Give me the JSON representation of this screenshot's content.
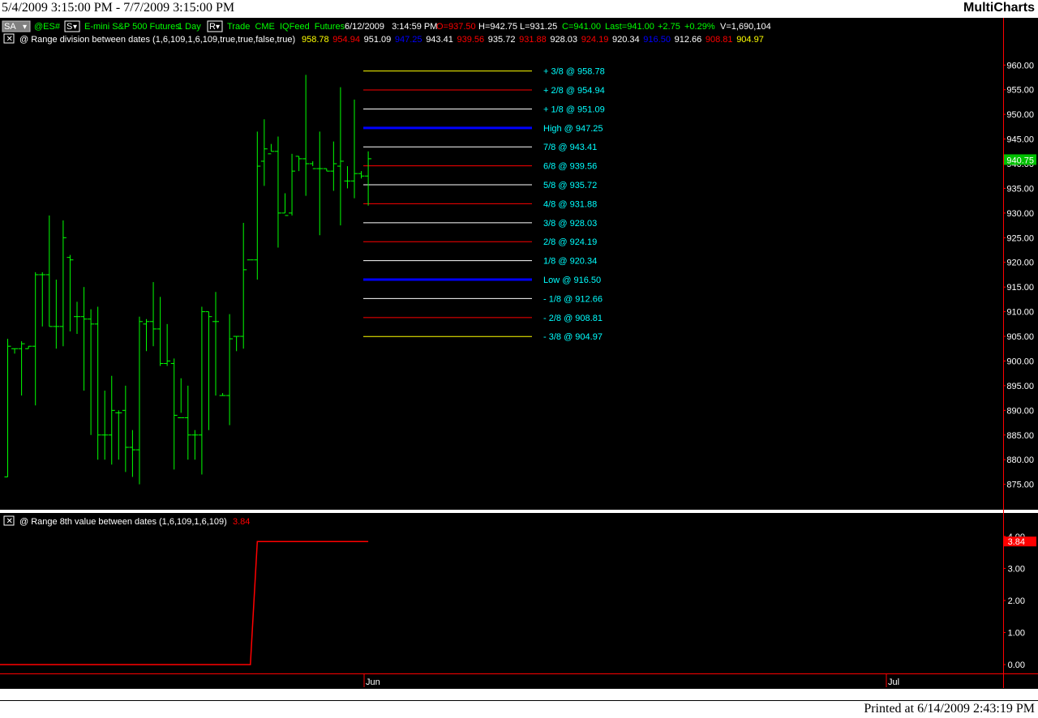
{
  "window": {
    "date_range": "5/4/2009 3:15:00 PM - 7/7/2009 3:15:00 PM",
    "app_name": "MultiCharts",
    "printed": "Printed at 6/14/2009 2:43:19 PM"
  },
  "colors": {
    "background": "#000000",
    "bar": "#00ff00",
    "axis_line": "#ff0000",
    "label_text": "#00ffff",
    "blue_level": "#0000ff",
    "yellow_level": "#ffff00",
    "red_level": "#ff0000",
    "white_level": "#ffffff",
    "last_price_bg": "#00c000",
    "indicator_bg": "#ff0000"
  },
  "header": {
    "sa_button": "SA",
    "symbol": "@ES#",
    "s_button": "S",
    "description": "E-mini S&P 500 Futures",
    "interval": "1 Day",
    "r_button": "R",
    "feed": "Trade  CME  IQFeed  Futures",
    "datetime": "6/12/2009   3:14:59 PM",
    "open": "O=937.50",
    "high": "H=942.75",
    "low": "L=931.25",
    "close": "C=941.00",
    "last": "Last=941.00",
    "change": "+2.75",
    "pct": "+0.29%",
    "volume": "V=1,690,104"
  },
  "study1": {
    "name": "@ Range division between dates  (1,6,109,1,6,109,true,true,false,true)",
    "values": [
      {
        "text": "958.78",
        "color": "#ffff00"
      },
      {
        "text": "954.94",
        "color": "#ff0000"
      },
      {
        "text": "951.09",
        "color": "#ffffff"
      },
      {
        "text": "947.25",
        "color": "#0000ff"
      },
      {
        "text": "943.41",
        "color": "#ffffff"
      },
      {
        "text": "939.56",
        "color": "#ff0000"
      },
      {
        "text": "935.72",
        "color": "#ffffff"
      },
      {
        "text": "931.88",
        "color": "#ff0000"
      },
      {
        "text": "928.03",
        "color": "#ffffff"
      },
      {
        "text": "924.19",
        "color": "#ff0000"
      },
      {
        "text": "920.34",
        "color": "#ffffff"
      },
      {
        "text": "916.50",
        "color": "#0000ff"
      },
      {
        "text": "912.66",
        "color": "#ffffff"
      },
      {
        "text": "908.81",
        "color": "#ff0000"
      },
      {
        "text": "904.97",
        "color": "#ffff00"
      }
    ]
  },
  "study2": {
    "name": "@ Range 8th value between dates  (1,6,109,1,6,109)",
    "value": "3.84"
  },
  "chart_data": [
    {
      "type": "ohlc",
      "ylim": [
        871,
        963
      ],
      "y_ticks": [
        "875.00",
        "880.00",
        "885.00",
        "890.00",
        "895.00",
        "900.00",
        "905.00",
        "910.00",
        "915.00",
        "920.00",
        "925.00",
        "930.00",
        "935.00",
        "940.00",
        "945.00",
        "950.00",
        "955.00",
        "960.00"
      ],
      "last_price": "940.75",
      "x_ticks": [
        "Jun",
        "Jul"
      ],
      "bars": [
        {
          "h": 904.5,
          "l": 876.5,
          "o": 876.5,
          "c": 903.0
        },
        {
          "h": 902.5,
          "l": 901.5,
          "o": 902.5,
          "c": 902.5
        },
        {
          "h": 904.0,
          "l": 893.0,
          "o": 902.5,
          "c": 903.5
        },
        {
          "h": 903.0,
          "l": 902.5,
          "o": 902.5,
          "c": 903.0
        },
        {
          "h": 918.0,
          "l": 891.0,
          "o": 903.0,
          "c": 917.5
        },
        {
          "h": 918.0,
          "l": 907.0,
          "o": 917.5,
          "c": 917.5
        },
        {
          "h": 929.5,
          "l": 907.0,
          "o": 917.5,
          "c": 907.0
        },
        {
          "h": 916.5,
          "l": 902.5,
          "o": 907.0,
          "c": 907.0
        },
        {
          "h": 928.5,
          "l": 903.0,
          "o": 907.0,
          "c": 925.0
        },
        {
          "h": 921.5,
          "l": 906.0,
          "o": 921.0,
          "c": 920.5
        },
        {
          "h": 912.0,
          "l": 905.5,
          "o": 909.0,
          "c": 909.0
        },
        {
          "h": 915.0,
          "l": 894.0,
          "o": 909.0,
          "c": 908.5
        },
        {
          "h": 910.5,
          "l": 885.0,
          "o": 908.5,
          "c": 907.5
        },
        {
          "h": 911.0,
          "l": 880.0,
          "o": 907.5,
          "c": 885.0
        },
        {
          "h": 894.0,
          "l": 880.0,
          "o": 885.0,
          "c": 885.0
        },
        {
          "h": 897.0,
          "l": 879.0,
          "o": 885.0,
          "c": 890.0
        },
        {
          "h": 890.0,
          "l": 880.0,
          "o": 889.5,
          "c": 889.5
        },
        {
          "h": 895.0,
          "l": 877.5,
          "o": 890.0,
          "c": 882.5
        },
        {
          "h": 886.0,
          "l": 876.5,
          "o": 882.5,
          "c": 882.0
        },
        {
          "h": 909.0,
          "l": 875.0,
          "o": 882.0,
          "c": 908.0
        },
        {
          "h": 908.5,
          "l": 902.0,
          "o": 907.5,
          "c": 908.0
        },
        {
          "h": 916.0,
          "l": 903.0,
          "o": 908.0,
          "c": 906.5
        },
        {
          "h": 913.0,
          "l": 899.0,
          "o": 906.5,
          "c": 899.5
        },
        {
          "h": 907.5,
          "l": 899.0,
          "o": 899.5,
          "c": 900.0
        },
        {
          "h": 900.5,
          "l": 878.0,
          "o": 899.5,
          "c": 889.0
        },
        {
          "h": 896.5,
          "l": 889.5,
          "o": 888.5,
          "c": 888.5
        },
        {
          "h": 895.0,
          "l": 880.0,
          "o": 888.5,
          "c": 885.0
        },
        {
          "h": 886.0,
          "l": 880.0,
          "o": 885.0,
          "c": 885.0
        },
        {
          "h": 911.0,
          "l": 877.0,
          "o": 885.0,
          "c": 910.0
        },
        {
          "h": 910.0,
          "l": 886.0,
          "o": 910.0,
          "c": 909.0
        },
        {
          "h": 914.0,
          "l": 893.0,
          "o": 908.0,
          "c": 908.0
        },
        {
          "h": 893.5,
          "l": 893.0,
          "o": 893.0,
          "c": 893.0
        },
        {
          "h": 909.5,
          "l": 887.0,
          "o": 893.0,
          "c": 904.5
        },
        {
          "h": 905.0,
          "l": 902.0,
          "o": 905.0,
          "c": 905.0
        },
        {
          "h": 928.0,
          "l": 902.5,
          "o": 905.0,
          "c": 918.5
        },
        {
          "h": 920.5,
          "l": 920.5,
          "o": 920.5,
          "c": 920.5
        },
        {
          "h": 946.5,
          "l": 916.5,
          "o": 920.5,
          "c": 939.5
        },
        {
          "h": 949.0,
          "l": 935.5,
          "o": 940.5,
          "c": 943.0
        },
        {
          "h": 944.0,
          "l": 942.5,
          "o": 942.0,
          "c": 942.5
        },
        {
          "h": 945.5,
          "l": 923.0,
          "o": 942.5,
          "c": 930.0
        },
        {
          "h": 934.0,
          "l": 930.0,
          "o": 930.0,
          "c": 929.5
        },
        {
          "h": 942.0,
          "l": 929.5,
          "o": 930.0,
          "c": 938.5
        },
        {
          "h": 941.5,
          "l": 938.5,
          "o": 941.5,
          "c": 941.0
        },
        {
          "h": 958.0,
          "l": 933.5,
          "o": 941.0,
          "c": 940.0
        },
        {
          "h": 940.5,
          "l": 939.5,
          "o": 940.0,
          "c": 939.0
        },
        {
          "h": 946.5,
          "l": 925.5,
          "o": 939.0,
          "c": 939.0
        },
        {
          "h": 939.0,
          "l": 938.5,
          "o": 939.0,
          "c": 938.5
        },
        {
          "h": 944.5,
          "l": 934.5,
          "o": 938.5,
          "c": 940.0
        },
        {
          "h": 955.5,
          "l": 927.5,
          "o": 939.5,
          "c": 940.5
        },
        {
          "h": 939.5,
          "l": 935.0,
          "o": 936.5,
          "c": 936.5
        },
        {
          "h": 953.0,
          "l": 933.0,
          "o": 936.5,
          "c": 938.0
        },
        {
          "h": 938.5,
          "l": 937.0,
          "o": 938.0,
          "c": 937.5
        },
        {
          "h": 942.5,
          "l": 931.5,
          "o": 937.5,
          "c": 941.0
        }
      ],
      "levels": [
        {
          "label": "+ 3/8 @ 958.78",
          "value": 958.78,
          "color": "#ffff00",
          "width": 1
        },
        {
          "label": "+ 2/8 @ 954.94",
          "value": 954.94,
          "color": "#ff0000",
          "width": 1
        },
        {
          "label": "+ 1/8 @ 951.09",
          "value": 951.09,
          "color": "#ffffff",
          "width": 1
        },
        {
          "label": "High @ 947.25",
          "value": 947.25,
          "color": "#0000ff",
          "width": 3
        },
        {
          "label": "7/8 @ 943.41",
          "value": 943.41,
          "color": "#ffffff",
          "width": 1
        },
        {
          "label": "6/8 @ 939.56",
          "value": 939.56,
          "color": "#ff0000",
          "width": 1
        },
        {
          "label": "5/8 @ 935.72",
          "value": 935.72,
          "color": "#ffffff",
          "width": 1
        },
        {
          "label": "4/8 @ 931.88",
          "value": 931.88,
          "color": "#ff0000",
          "width": 1
        },
        {
          "label": "3/8 @ 928.03",
          "value": 928.03,
          "color": "#ffffff",
          "width": 1
        },
        {
          "label": "2/8 @ 924.19",
          "value": 924.19,
          "color": "#ff0000",
          "width": 1
        },
        {
          "label": "1/8 @ 920.34",
          "value": 920.34,
          "color": "#ffffff",
          "width": 1
        },
        {
          "label": "Low  @ 916.50",
          "value": 916.5,
          "color": "#0000ff",
          "width": 3
        },
        {
          "label": "- 1/8 @ 912.66",
          "value": 912.66,
          "color": "#ffffff",
          "width": 1
        },
        {
          "label": "- 2/8 @ 908.81",
          "value": 908.81,
          "color": "#ff0000",
          "width": 1
        },
        {
          "label": "- 3/8 @ 904.97",
          "value": 904.97,
          "color": "#ffff00",
          "width": 1
        }
      ]
    },
    {
      "type": "line",
      "ylim": [
        -0.2,
        4.3
      ],
      "y_ticks": [
        "0.00",
        "1.00",
        "2.00",
        "3.00",
        "4.00"
      ],
      "last_value": "3.84",
      "series": [
        {
          "points": [
            [
              0,
              0.0
            ],
            [
              35,
              0.0
            ],
            [
              36,
              3.84
            ],
            [
              52,
              3.84
            ]
          ],
          "color": "#ff0000"
        }
      ]
    }
  ]
}
